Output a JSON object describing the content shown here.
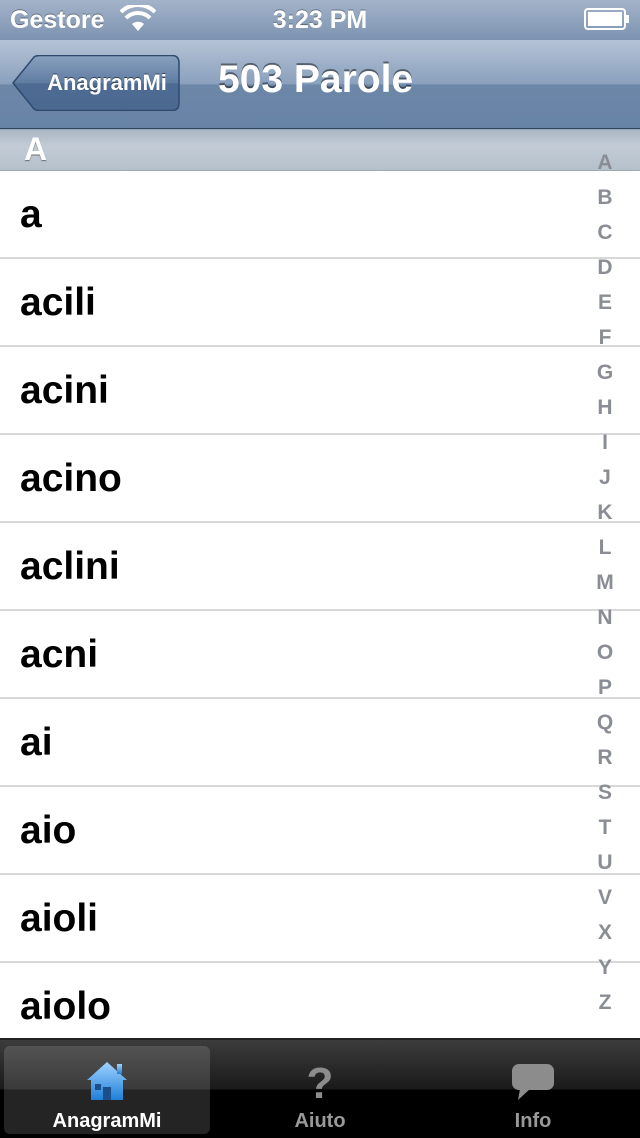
{
  "status_bar": {
    "carrier": "Gestore",
    "time": "3:23 PM"
  },
  "nav": {
    "back_label": "AnagramMi",
    "title": "503 Parole"
  },
  "section": {
    "header": "A"
  },
  "words": [
    "a",
    "acili",
    "acini",
    "acino",
    "aclini",
    "acni",
    "ai",
    "aio",
    "aioli",
    "aiolo"
  ],
  "index_letters": [
    "A",
    "B",
    "C",
    "D",
    "E",
    "F",
    "G",
    "H",
    "I",
    "J",
    "K",
    "L",
    "M",
    "N",
    "O",
    "P",
    "Q",
    "R",
    "S",
    "T",
    "U",
    "V",
    "X",
    "Y",
    "Z"
  ],
  "tabs": [
    {
      "label": "AnagramMi",
      "icon": "home-icon",
      "selected": true
    },
    {
      "label": "Aiuto",
      "icon": "question-icon",
      "selected": false
    },
    {
      "label": "Info",
      "icon": "speech-bubble-icon",
      "selected": false
    }
  ],
  "colors": {
    "nav_bar": "#7089aa",
    "tab_bar": "#000000",
    "selected_tab_icon": "#4aa3f0"
  }
}
